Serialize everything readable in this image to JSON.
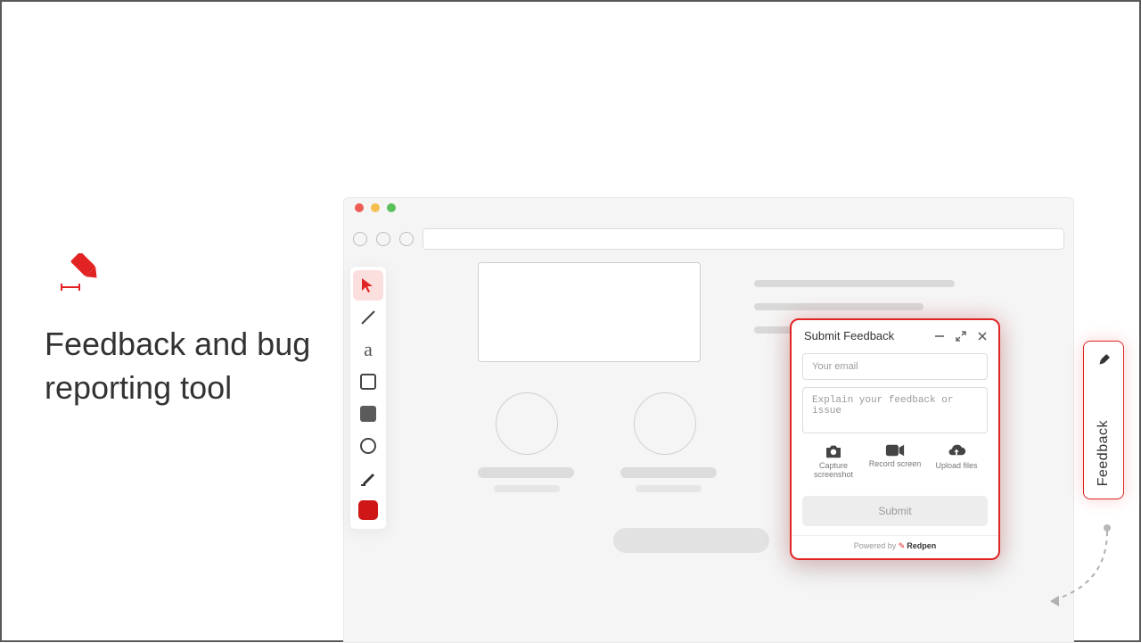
{
  "colors": {
    "accent": "#e22323"
  },
  "hero": {
    "title": "Feedback and bug reporting tool"
  },
  "toolbar": {
    "items": [
      {
        "name": "cursor-icon"
      },
      {
        "name": "line-icon"
      },
      {
        "name": "text-icon"
      },
      {
        "name": "rectangle-outline-icon"
      },
      {
        "name": "rectangle-fill-icon"
      },
      {
        "name": "circle-outline-icon"
      },
      {
        "name": "highlighter-icon"
      },
      {
        "name": "color-swatch-icon"
      }
    ]
  },
  "widget": {
    "title": "Submit Feedback",
    "email_placeholder": "Your email",
    "textarea_placeholder": "Explain your feedback or issue",
    "actions": {
      "capture": "Capture screenshot",
      "record": "Record screen",
      "upload": "Upload files"
    },
    "submit": "Submit",
    "footer_prefix": "Powered by ",
    "footer_brand": "Redpen"
  },
  "tab": {
    "label": "Feedback"
  }
}
